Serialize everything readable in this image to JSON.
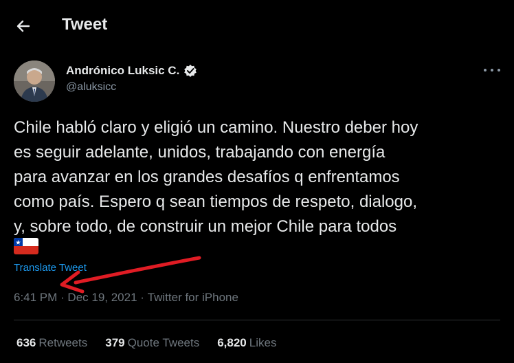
{
  "header": {
    "title": "Tweet"
  },
  "author": {
    "name": "Andrónico Luksic C.",
    "handle": "@aluksicc"
  },
  "tweet": {
    "text": "Chile habló claro y eligió un camino. Nuestro deber hoy\nes seguir adelante, unidos, trabajando con energía\npara avanzar en los grandes desafíos q enfrentamos\ncomo país. Espero q sean tiempos de respeto, dialogo,\ny, sobre todo, de construir un mejor Chile para todos",
    "translate_label": "Translate Tweet",
    "time": "6:41 PM",
    "separator": " · ",
    "date": "Dec 19, 2021",
    "source": "Twitter for iPhone"
  },
  "stats": {
    "retweets_count": "636",
    "retweets_label": "Retweets",
    "quotes_count": "379",
    "quotes_label": "Quote Tweets",
    "likes_count": "6,820",
    "likes_label": "Likes"
  },
  "colors": {
    "background": "#000000",
    "link": "#1d9bf0",
    "muted": "#6e767d",
    "annotation_arrow": "#e01c24"
  },
  "icons": {
    "back": "arrow-left-icon",
    "verified": "verified-badge-icon",
    "more": "more-horizontal-icon",
    "flag": "chile-flag-icon"
  }
}
